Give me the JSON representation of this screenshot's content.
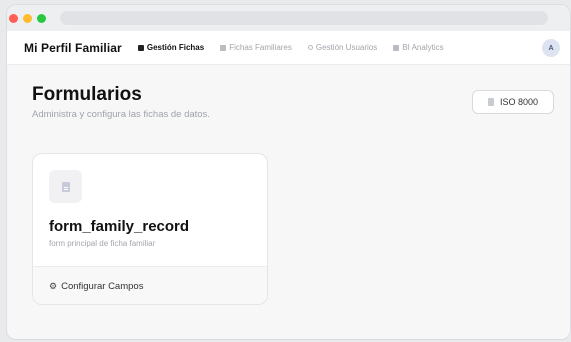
{
  "navbar": {
    "brand": "Mi Perfil Familiar",
    "items": [
      {
        "label": "Gestión Fichas",
        "icon": "square-icon",
        "active": true
      },
      {
        "label": "Fichas Familiares",
        "icon": "square-icon",
        "active": false
      },
      {
        "label": "Gestión Usuarios",
        "icon": "circle-icon",
        "active": false
      },
      {
        "label": "BI Analytics",
        "icon": "square-icon",
        "active": false
      }
    ],
    "avatar_initial": "A"
  },
  "page": {
    "title": "Formularios",
    "subtitle": "Administra y configura las fichas de datos.",
    "iso_button_label": "ISO 8000"
  },
  "card": {
    "icon": "document-icon",
    "title": "form_family_record",
    "description": "form principal de ficha familiar",
    "footer_icon": "⚙",
    "footer_label": "Configurar Campos"
  },
  "colors": {
    "window_close": "#ff5f57",
    "window_minimize": "#febc2e",
    "window_maximize": "#28c840",
    "avatar_bg": "#dde3f1"
  }
}
